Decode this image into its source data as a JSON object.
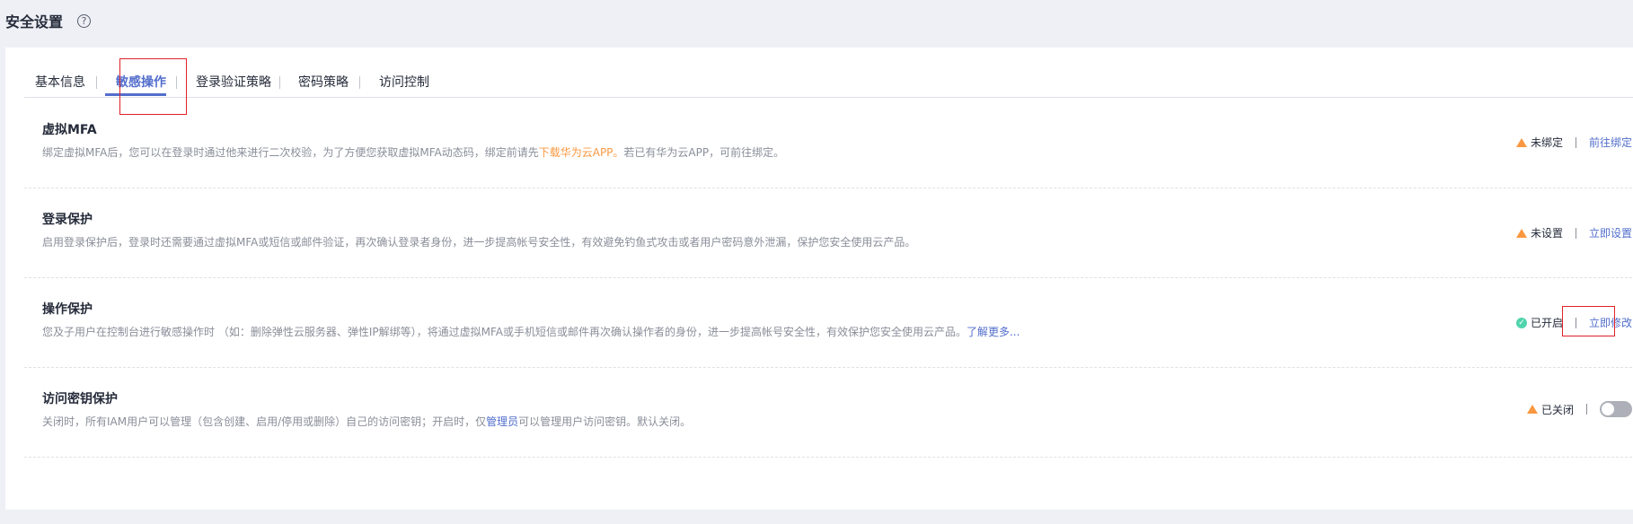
{
  "page": {
    "title": "安全设置",
    "help_icon": "?"
  },
  "tabs": [
    {
      "label": "基本信息",
      "active": false
    },
    {
      "label": "敏感操作",
      "active": true
    },
    {
      "label": "登录验证策略",
      "active": false
    },
    {
      "label": "密码策略",
      "active": false
    },
    {
      "label": "访问控制",
      "active": false
    }
  ],
  "rows": {
    "mfa": {
      "title": "虚拟MFA",
      "desc_before": "绑定虚拟MFA后，您可以在登录时通过他来进行二次校验，为了方便您获取虚拟MFA动态码，绑定前请先",
      "desc_link": "下载华为云APP。",
      "desc_after": "若已有华为云APP，可前往绑定。",
      "status_icon": "warning-icon",
      "status": "未绑定",
      "action": "前往绑定"
    },
    "login": {
      "title": "登录保护",
      "desc": "启用登录保护后，登录时还需要通过虚拟MFA或短信或邮件验证，再次确认登录者身份，进一步提高帐号安全性，有效避免钓鱼式攻击或者用户密码意外泄漏，保护您安全使用云产品。",
      "status_icon": "warning-icon",
      "status": "未设置",
      "action": "立即设置"
    },
    "operation": {
      "title": "操作保护",
      "desc": "您及子用户在控制台进行敏感操作时 （如：删除弹性云服务器、弹性IP解绑等），将通过虚拟MFA或手机短信或邮件再次确认操作者的身份，进一步提高帐号安全性，有效保护您安全使用云产品。",
      "desc_link": "了解更多...",
      "status_icon": "check-circle-icon",
      "status": "已开启",
      "action": "立即修改"
    },
    "access_key": {
      "title": "访问密钥保护",
      "desc_before": "关闭时，所有IAM用户可以管理（包含创建、启用/停用或删除）自己的访问密钥；开启时，仅",
      "desc_link": "管理员",
      "desc_after": "可以管理用户访问密钥。默认关闭。",
      "status_icon": "warning-icon",
      "status": "已关闭",
      "toggle_on": false
    }
  },
  "colors": {
    "accent": "#526ecc",
    "warning": "#fa9841",
    "success": "#50d4ab",
    "highlight": "#e0202a"
  }
}
